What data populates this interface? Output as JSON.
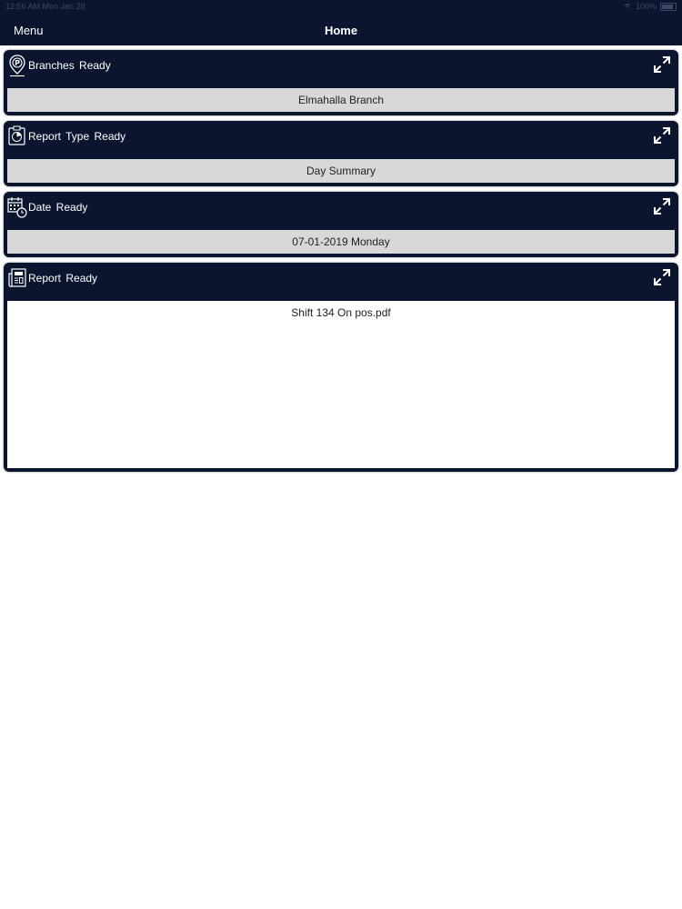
{
  "status_bar": {
    "time": "12:56 AM",
    "date": "Mon Jan 28",
    "battery": "100%"
  },
  "header": {
    "menu_label": "Menu",
    "title": "Home"
  },
  "cards": [
    {
      "icon": "parking-pin-icon",
      "title": "Branches Ready",
      "value": "Elmahalla Branch"
    },
    {
      "icon": "report-type-icon",
      "title": "Report Type Ready",
      "value": "Day Summary"
    },
    {
      "icon": "calendar-clock-icon",
      "title": "Date Ready",
      "value": "07-01-2019 Monday"
    },
    {
      "icon": "report-newspaper-icon",
      "title": "Report Ready",
      "value": "Shift 134 On pos.pdf"
    }
  ],
  "colors": {
    "header_bg": "#0b1530",
    "value_bg": "#d8d8d8",
    "text_light": "#ffffff",
    "text_dark": "#222222"
  }
}
